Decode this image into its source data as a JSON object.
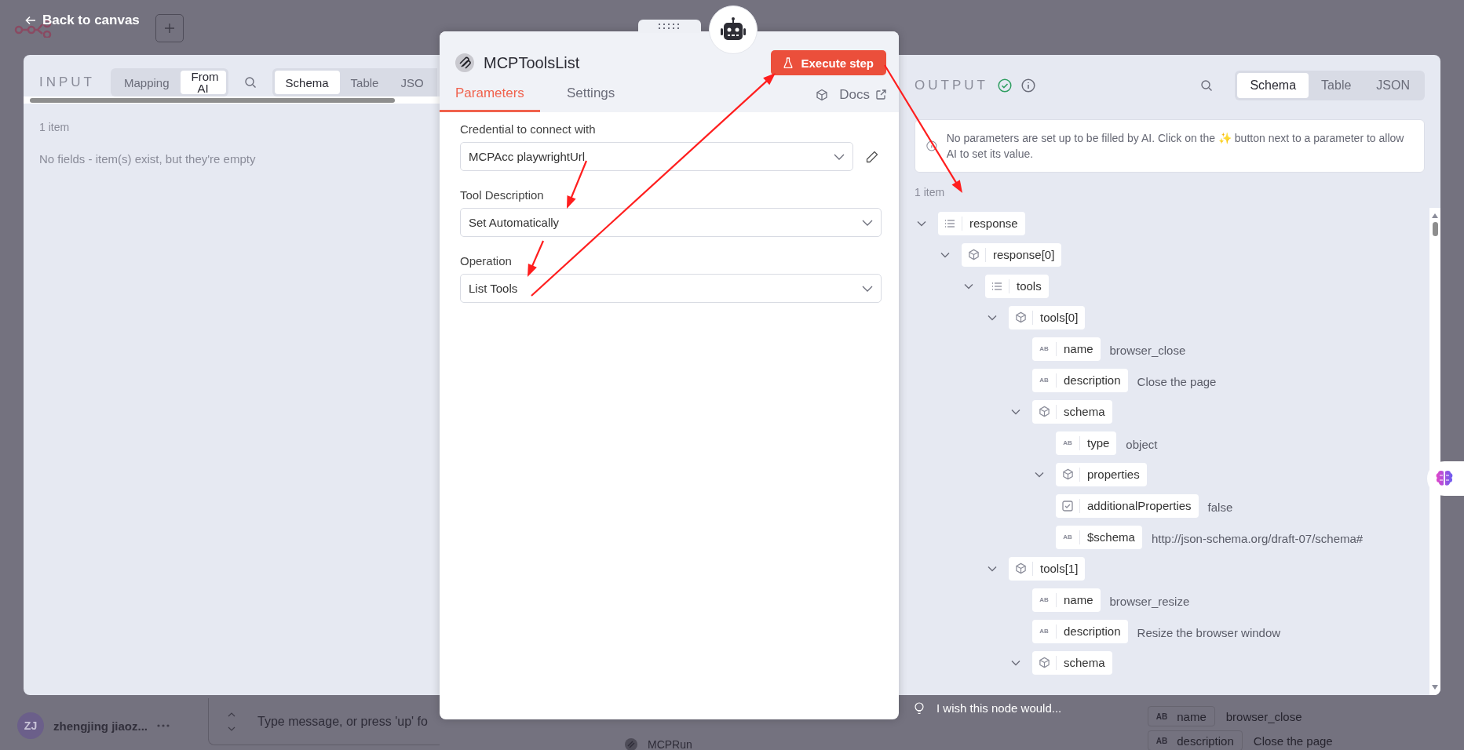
{
  "top_bar": {
    "back_label": "Back to canvas"
  },
  "background": {
    "user": {
      "initials": "ZJ",
      "name": "zhengjing jiaoz..."
    },
    "chat_placeholder": "Type message, or press 'up' fo",
    "node_label": "MCPRun",
    "fields": [
      {
        "key": "name",
        "value": "browser_close",
        "icon_text": "AB"
      },
      {
        "key": "description",
        "value": "Close the page",
        "icon_text": "AB"
      }
    ]
  },
  "input": {
    "title": "INPUT",
    "mode_tabs": [
      {
        "label": "Mapping",
        "selected": false
      },
      {
        "label": "From AI",
        "selected": true
      }
    ],
    "view_tabs": [
      {
        "label": "Schema",
        "selected": true
      },
      {
        "label": "Table",
        "selected": false
      },
      {
        "label": "JSO",
        "selected": false
      }
    ],
    "item_count": "1 item",
    "empty_message": "No fields - item(s) exist, but they're empty"
  },
  "node": {
    "title": "MCPToolsList",
    "execute_label": "Execute step",
    "tabs": [
      {
        "label": "Parameters",
        "selected": true
      },
      {
        "label": "Settings",
        "selected": false
      }
    ],
    "docs_label": "Docs",
    "fields": [
      {
        "label": "Credential to connect with",
        "value": "MCPAcc playwrightUrl",
        "editable": true
      },
      {
        "label": "Tool Description",
        "value": "Set Automatically",
        "editable": false
      },
      {
        "label": "Operation",
        "value": "List Tools",
        "editable": false
      }
    ]
  },
  "output": {
    "title": "OUTPUT",
    "success": true,
    "view_tabs": [
      {
        "label": "Schema",
        "selected": true
      },
      {
        "label": "Table",
        "selected": false
      },
      {
        "label": "JSON",
        "selected": false
      }
    ],
    "notice": "No parameters are set up to be filled by AI. Click on the ✨ button next to a parameter to allow AI to set its value.",
    "item_count": "1 item",
    "tree": [
      {
        "key": "response",
        "kind": "array",
        "expanded": true,
        "children": [
          {
            "key": "response[0]",
            "kind": "object",
            "expanded": true,
            "children": [
              {
                "key": "tools",
                "kind": "array",
                "expanded": true,
                "children": [
                  {
                    "key": "tools[0]",
                    "kind": "object",
                    "expanded": true,
                    "children": [
                      {
                        "key": "name",
                        "kind": "string",
                        "icon_text": "AB",
                        "value": "browser_close"
                      },
                      {
                        "key": "description",
                        "kind": "string",
                        "icon_text": "AB",
                        "value": "Close the page"
                      },
                      {
                        "key": "schema",
                        "kind": "object",
                        "expanded": true,
                        "children": [
                          {
                            "key": "type",
                            "kind": "string",
                            "icon_text": "AB",
                            "value": "object"
                          },
                          {
                            "key": "properties",
                            "kind": "object",
                            "expanded": true
                          },
                          {
                            "key": "additionalProperties",
                            "kind": "boolean",
                            "value": "false"
                          },
                          {
                            "key": "$schema",
                            "kind": "string",
                            "icon_text": "AB",
                            "value": "http://json-schema.org/draft-07/schema#"
                          }
                        ]
                      }
                    ]
                  },
                  {
                    "key": "tools[1]",
                    "kind": "object",
                    "expanded": true,
                    "children": [
                      {
                        "key": "name",
                        "kind": "string",
                        "icon_text": "AB",
                        "value": "browser_resize"
                      },
                      {
                        "key": "description",
                        "kind": "string",
                        "icon_text": "AB",
                        "value": "Resize the browser window"
                      },
                      {
                        "key": "schema",
                        "kind": "object",
                        "expanded": true
                      }
                    ]
                  }
                ]
              }
            ]
          }
        ]
      }
    ]
  },
  "feedback": {
    "label": "I wish this node would..."
  }
}
